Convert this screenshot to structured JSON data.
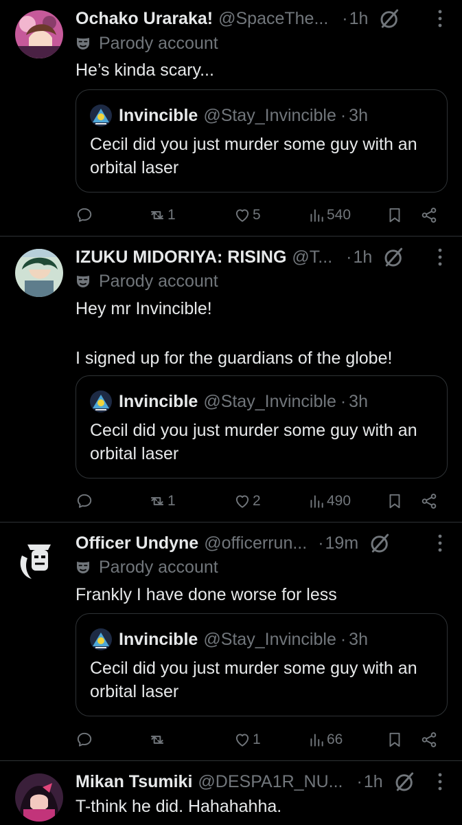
{
  "colors": {
    "background": "#000000",
    "text": "#e7e9ea",
    "muted": "#71767b",
    "border": "#2f3336"
  },
  "tweets": [
    {
      "name": "Ochako Uraraka!",
      "handle": "@SpaceThe...",
      "time": "1h",
      "parody": "Parody account",
      "text": "He’s kinda scary...",
      "quote": {
        "name": "Invincible",
        "handle": "@Stay_Invincible",
        "time": "3h",
        "text": "Cecil did you just murder some guy with an orbital laser"
      },
      "stats": {
        "retweets": "1",
        "likes": "5",
        "views": "540"
      }
    },
    {
      "name": "IZUKU MIDORIYA: RISING",
      "handle": "@T...",
      "time": "1h",
      "parody": "Parody account",
      "text": "Hey mr Invincible!\n\nI signed up for the guardians of the globe!",
      "quote": {
        "name": "Invincible",
        "handle": "@Stay_Invincible",
        "time": "3h",
        "text": "Cecil did you just murder some guy with an orbital laser"
      },
      "stats": {
        "retweets": "1",
        "likes": "2",
        "views": "490"
      }
    },
    {
      "name": "Officer Undyne",
      "handle": "@officerrun...",
      "time": "19m",
      "parody": "Parody account",
      "text": "Frankly I have done worse for less",
      "quote": {
        "name": "Invincible",
        "handle": "@Stay_Invincible",
        "time": "3h",
        "text": "Cecil did you just murder some guy with an orbital laser"
      },
      "stats": {
        "retweets": "",
        "likes": "1",
        "views": "66"
      }
    },
    {
      "name": "Mikan Tsumiki",
      "handle": "@DESPA1R_NU...",
      "time": "1h",
      "text": "T-think he did. Hahahahha."
    }
  ],
  "icons": [
    "reply-icon",
    "retweet-icon",
    "like-icon",
    "views-icon",
    "bookmark-icon",
    "share-icon",
    "grok-icon",
    "more-icon",
    "parody-mask-icon"
  ]
}
